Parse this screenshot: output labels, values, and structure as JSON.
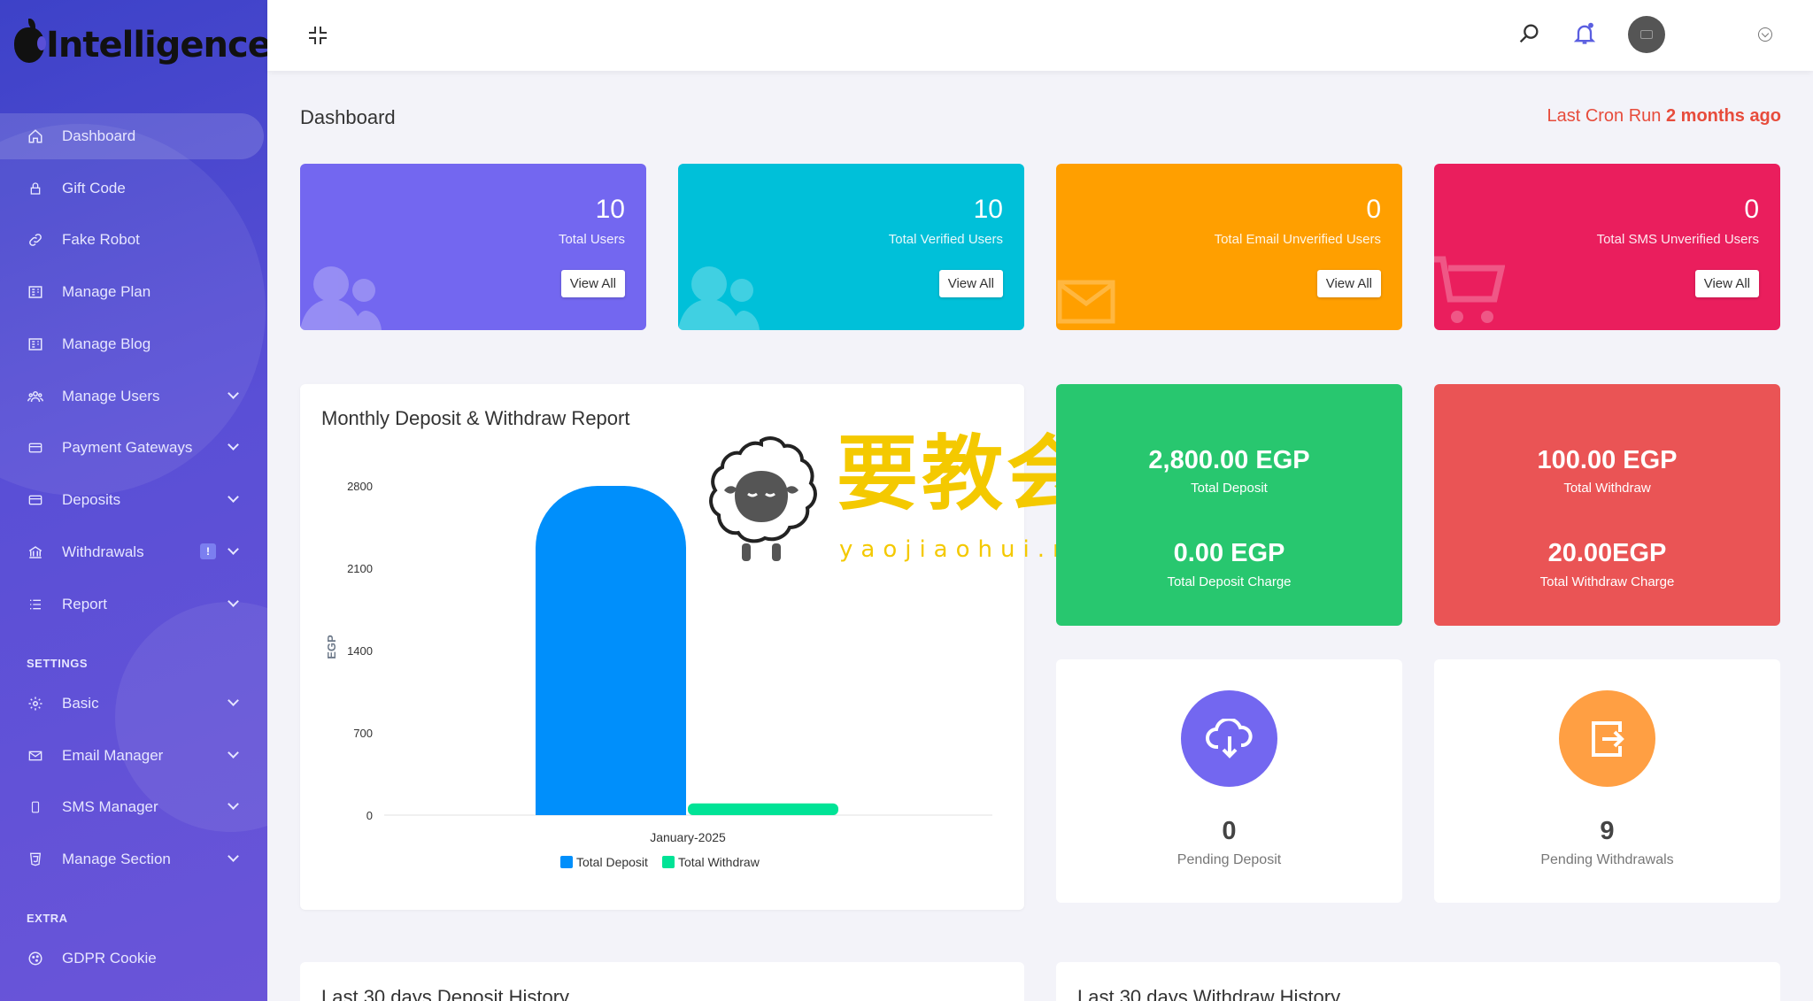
{
  "sidebar": {
    "brand": "Intelligence",
    "items": [
      {
        "label": "Dashboard"
      },
      {
        "label": "Gift Code"
      },
      {
        "label": "Fake Robot"
      },
      {
        "label": "Manage Plan"
      },
      {
        "label": "Manage Blog"
      },
      {
        "label": "Manage Users"
      },
      {
        "label": "Payment Gateways"
      },
      {
        "label": "Deposits"
      },
      {
        "label": "Withdrawals",
        "badge": "!"
      },
      {
        "label": "Report"
      }
    ],
    "settings_title": "SETTINGS",
    "settings_items": [
      {
        "label": "Basic"
      },
      {
        "label": "Email Manager"
      },
      {
        "label": "SMS Manager"
      },
      {
        "label": "Manage Section"
      }
    ],
    "extra_title": "EXTRA",
    "extra_items": [
      {
        "label": "GDPR Cookie"
      }
    ]
  },
  "header": {
    "page_title": "Dashboard",
    "cron_label": "Last Cron Run",
    "cron_value": "2 months ago"
  },
  "stats": [
    {
      "value": "10",
      "label": "Total Users",
      "button": "View All",
      "color": "#7367f0"
    },
    {
      "value": "10",
      "label": "Total Verified Users",
      "button": "View All",
      "color": "#00c0d9"
    },
    {
      "value": "0",
      "label": "Total Email Unverified Users",
      "button": "View All",
      "color": "#ff9f00"
    },
    {
      "value": "0",
      "label": "Total SMS Unverified Users",
      "button": "View All",
      "color": "#ea1e5d"
    }
  ],
  "chart_data": {
    "type": "bar",
    "title": "Monthly Deposit & Withdraw Report",
    "categories": [
      "January-2025"
    ],
    "series": [
      {
        "name": "Total Deposit",
        "values": [
          2800
        ],
        "color": "#008ffb"
      },
      {
        "name": "Total Withdraw",
        "values": [
          100
        ],
        "color": "#00e396"
      }
    ],
    "ylabel": "EGP",
    "yticks": [
      0,
      700,
      1400,
      2100,
      2800
    ],
    "ylim": [
      0,
      2800
    ],
    "legend": "bottom"
  },
  "summary": {
    "deposit": {
      "total": "2,800.00 EGP",
      "total_label": "Total Deposit",
      "charge": "0.00 EGP",
      "charge_label": "Total Deposit Charge",
      "color": "#28c76f"
    },
    "withdraw": {
      "total": "100.00 EGP",
      "total_label": "Total Withdraw",
      "charge": "20.00EGP",
      "charge_label": "Total Withdraw Charge",
      "color": "#ea5455"
    }
  },
  "pending": [
    {
      "value": "0",
      "label": "Pending Deposit",
      "color": "#7367f0",
      "icon": "cloud-download-icon"
    },
    {
      "value": "9",
      "label": "Pending Withdrawals",
      "color": "#ff9f43",
      "icon": "sign-out-icon"
    }
  ],
  "history": {
    "deposit_title": "Last 30 days Deposit History",
    "withdraw_title": "Last 30 days Withdraw History"
  },
  "watermark": {
    "text": "要教会",
    "url": "yaojiaohui.net"
  }
}
